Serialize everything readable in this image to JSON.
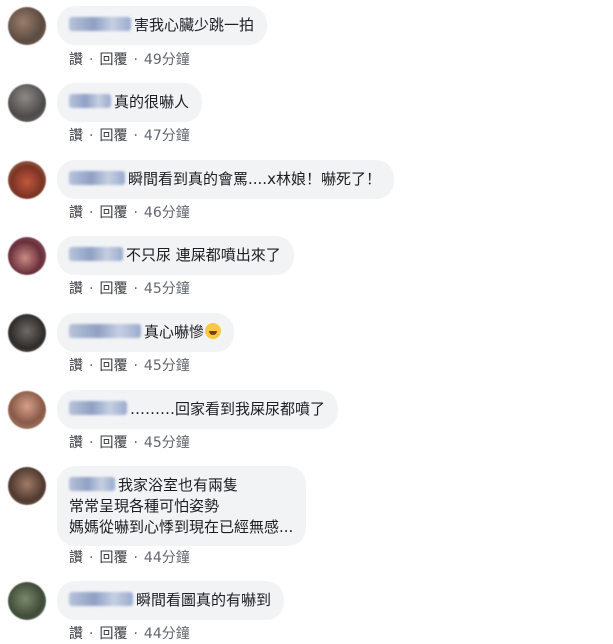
{
  "comments": [
    {
      "text": "害我心臟少跳一拍",
      "emoji": false,
      "like_label": "讚",
      "reply_label": "回覆",
      "time": "49分鐘"
    },
    {
      "text": "真的很嚇人",
      "emoji": false,
      "like_label": "讚",
      "reply_label": "回覆",
      "time": "47分鐘"
    },
    {
      "text": "瞬間看到真的會罵....x林娘！嚇死了！",
      "emoji": false,
      "like_label": "讚",
      "reply_label": "回覆",
      "time": "46分鐘"
    },
    {
      "text": "不只尿 連屎都噴出來了",
      "emoji": false,
      "like_label": "讚",
      "reply_label": "回覆",
      "time": "45分鐘"
    },
    {
      "text": "真心嚇慘",
      "emoji": true,
      "emoji_icon": "rolling-on-floor-laughing-emoji",
      "like_label": "讚",
      "reply_label": "回覆",
      "time": "45分鐘"
    },
    {
      "text": "………回家看到我屎尿都噴了",
      "emoji": false,
      "like_label": "讚",
      "reply_label": "回覆",
      "time": "45分鐘"
    },
    {
      "text_lines": [
        "我家浴室也有兩隻",
        "常常呈現各種可怕姿勢",
        "媽媽從嚇到心悸到現在已經無感..."
      ],
      "emoji": false,
      "like_label": "讚",
      "reply_label": "回覆",
      "time": "44分鐘"
    },
    {
      "text": "瞬間看圖真的有嚇到",
      "emoji": false,
      "like_label": "讚",
      "reply_label": "回覆",
      "time": "44分鐘"
    }
  ],
  "colors": {
    "bubble_bg": "#f2f3f5",
    "text": "#1c1e21",
    "meta": "#606770"
  }
}
